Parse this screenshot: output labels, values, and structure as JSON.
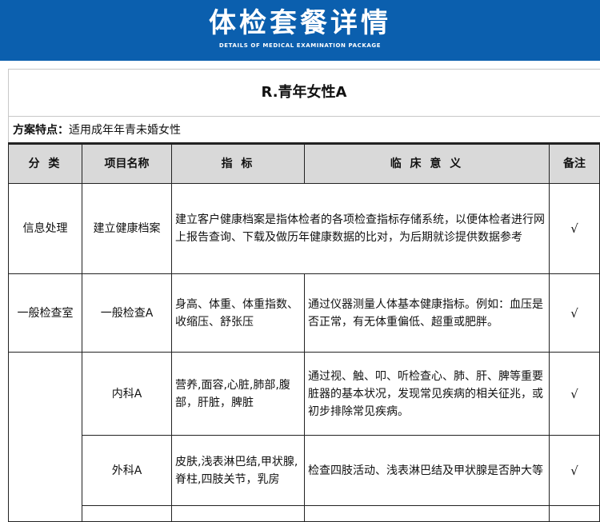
{
  "banner": {
    "title": "体检套餐详情",
    "subtitle": "DETAILS OF MEDICAL EXAMINATION PACKAGE"
  },
  "package": {
    "title": "R.青年女性A",
    "features_label": "方案特点：",
    "features_text": "适用成年年青未婚女性"
  },
  "table": {
    "headers": [
      "分 类",
      "项目名称",
      "指 标",
      "临 床 意 义",
      "备注"
    ],
    "rows": [
      {
        "category": "信息处理",
        "name": "建立健康档案",
        "merged_text": "建立客户健康档案是指体检者的各项检查指标存储系统，以便体检者进行网上报告查询、下载及做历年健康数据的比对，为后期就诊提供数据参考",
        "note": "√"
      },
      {
        "category": "一般检查室",
        "name": "一般检查A",
        "indicator": "身高、体重、体重指数、收缩压、舒张压",
        "meaning": "通过仪器测量人体基本健康指标。例如：血压是否正常，有无体重偏低、超重或肥胖。",
        "note": "√"
      },
      {
        "category": "",
        "name": "内科A",
        "indicator": "营养,面容,心脏,肺部,腹部，肝脏，脾脏",
        "meaning": "通过视、触、叩、听检查心、肺、肝、脾等重要脏器的基本状况，发现常见疾病的相关征兆，或初步排除常见疾病。",
        "note": "√"
      },
      {
        "category": "",
        "name": "外科A",
        "indicator": "皮肤,浅表淋巴结,甲状腺,脊柱,四肢关节，乳房",
        "meaning": "检查四肢活动、浅表淋巴结及甲状腺是否肿大等",
        "note": "√"
      }
    ]
  }
}
